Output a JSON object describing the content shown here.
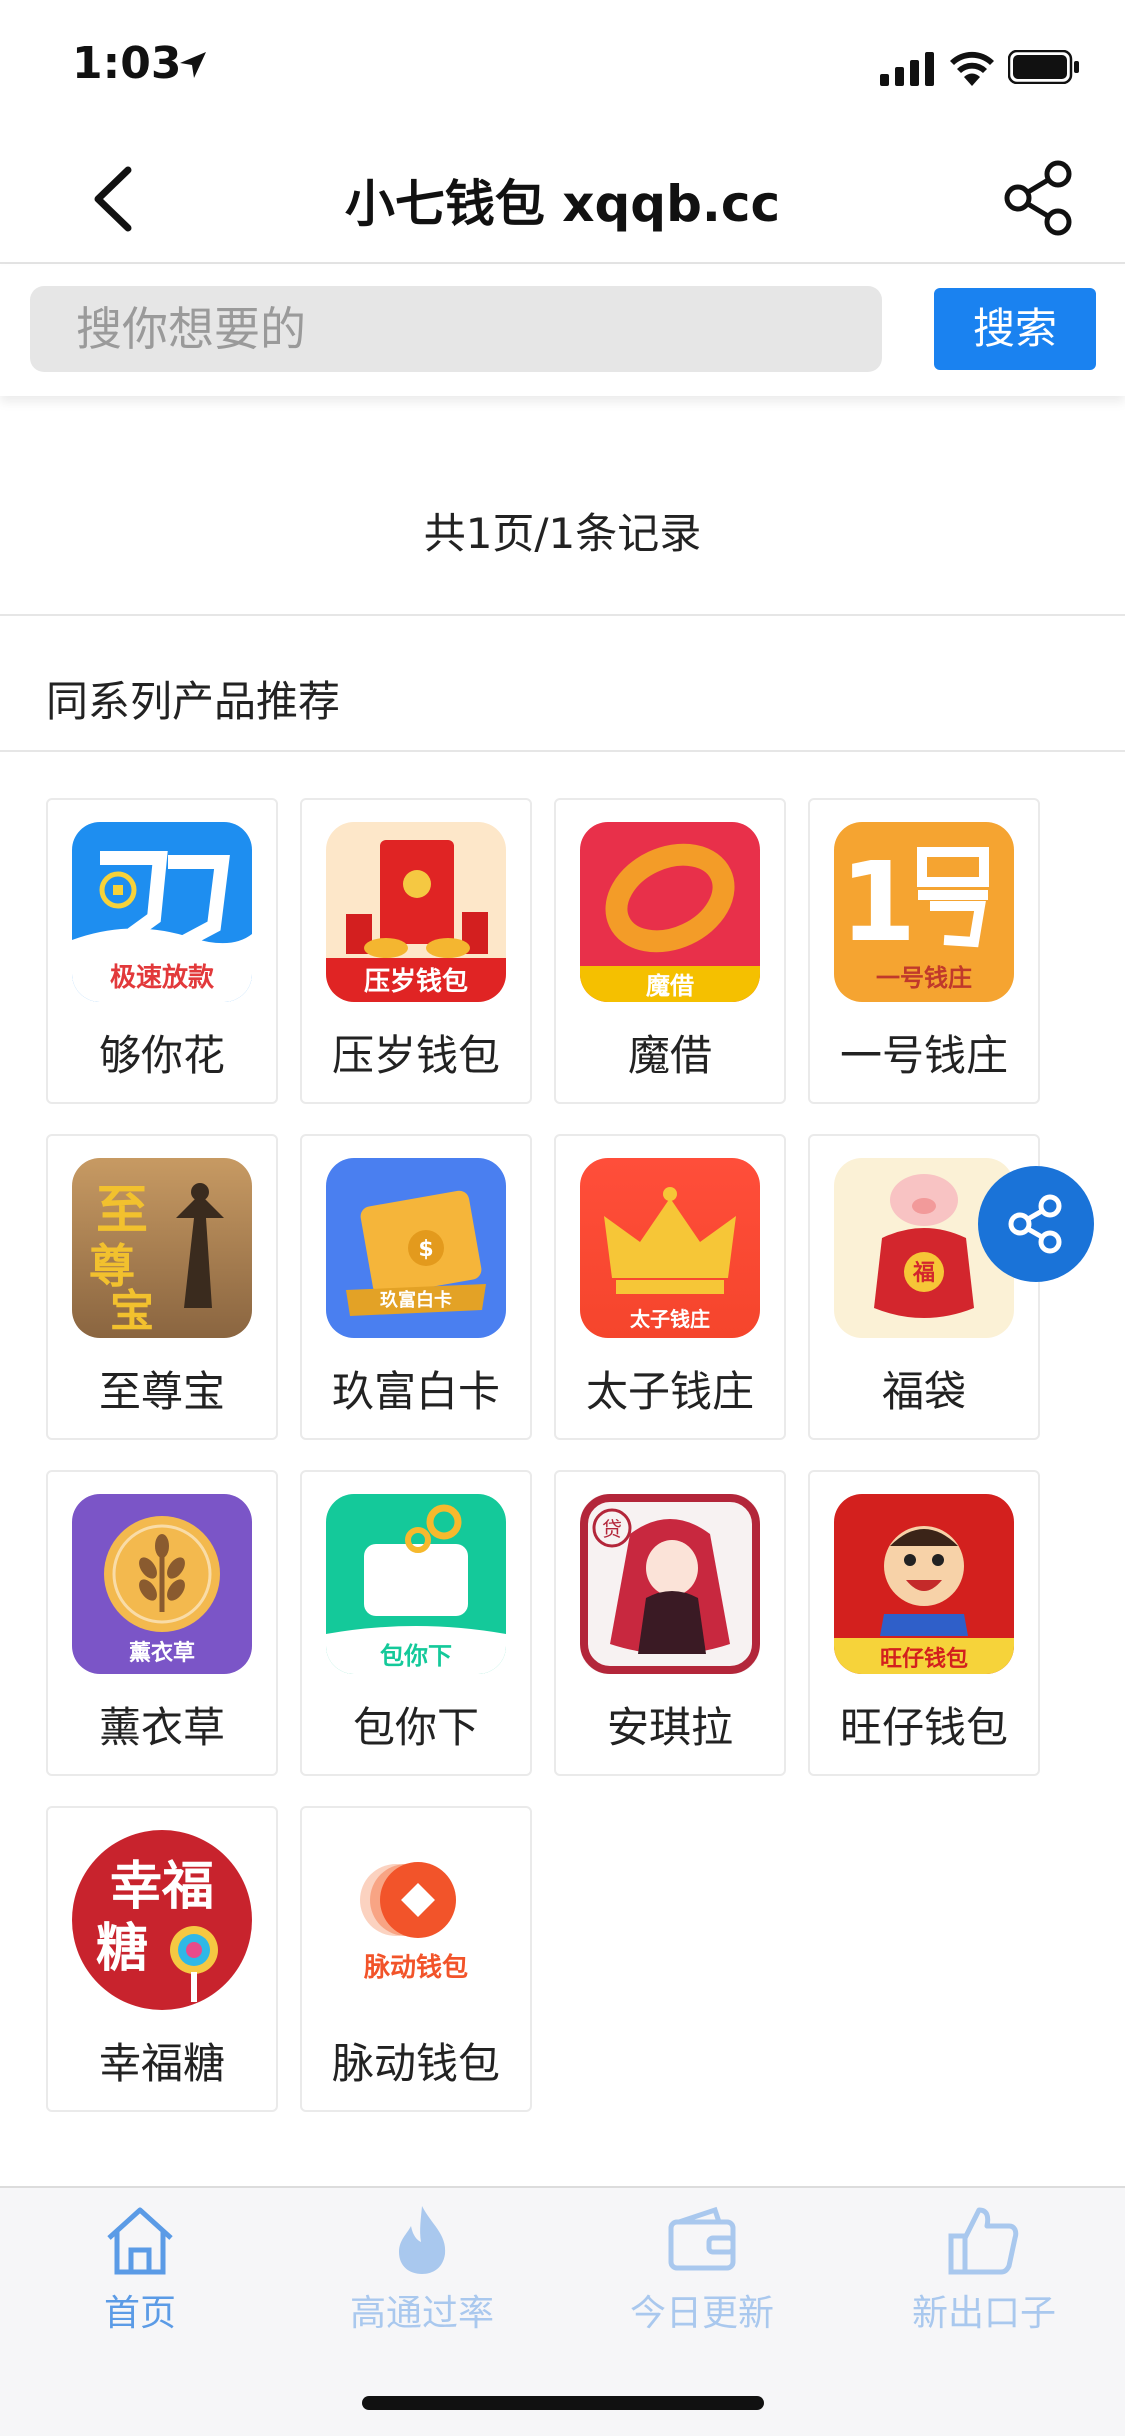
{
  "status": {
    "time": "1:03"
  },
  "nav": {
    "title": "小七钱包 xqqb.cc"
  },
  "search": {
    "placeholder": "搜你想要的",
    "button": "搜索"
  },
  "records": "共1页/1条记录",
  "section": {
    "title": "同系列产品推荐"
  },
  "apps": [
    {
      "name": "够你花",
      "icon_text": "极速放款",
      "icon": "money-hook-icon"
    },
    {
      "name": "压岁钱包",
      "icon_text": "压岁钱包",
      "icon": "red-envelope-icon"
    },
    {
      "name": "魔借",
      "icon_text": "魔借",
      "icon": "ring-icon"
    },
    {
      "name": "一号钱庄",
      "icon_text": "一号钱庄",
      "icon": "number-one-icon"
    },
    {
      "name": "至尊宝",
      "icon_text": "至尊宝",
      "icon": "monkey-king-icon"
    },
    {
      "name": "玖富白卡",
      "icon_text": "玖富白卡",
      "icon": "gold-card-icon"
    },
    {
      "name": "太子钱庄",
      "icon_text": "太子钱庄",
      "icon": "crown-icon"
    },
    {
      "name": "福袋",
      "icon_text": "福",
      "icon": "pig-lucky-bag-icon"
    },
    {
      "name": "薰衣草",
      "icon_text": "薰衣草",
      "icon": "lavender-icon"
    },
    {
      "name": "包你下",
      "icon_text": "包你下",
      "icon": "wallet-icon"
    },
    {
      "name": "安琪拉",
      "icon_text": "贷",
      "icon": "anime-girl-icon"
    },
    {
      "name": "旺仔钱包",
      "icon_text": "旺仔钱包",
      "icon": "wangzai-icon"
    },
    {
      "name": "幸福糖",
      "icon_text": "幸福糖",
      "icon": "lollipop-icon"
    },
    {
      "name": "脉动钱包",
      "icon_text": "脉动钱包",
      "icon": "pulse-icon"
    }
  ],
  "tabs": [
    {
      "label": "首页",
      "icon": "home-icon",
      "active": true
    },
    {
      "label": "高通过率",
      "icon": "flame-icon",
      "active": false
    },
    {
      "label": "今日更新",
      "icon": "wallet-icon",
      "active": false
    },
    {
      "label": "新出口子",
      "icon": "thumbs-up-icon",
      "active": false
    }
  ],
  "colors": {
    "accent": "#1a82f0",
    "tab_active": "#5b9be6",
    "tab_inactive": "#a9c8ee"
  }
}
